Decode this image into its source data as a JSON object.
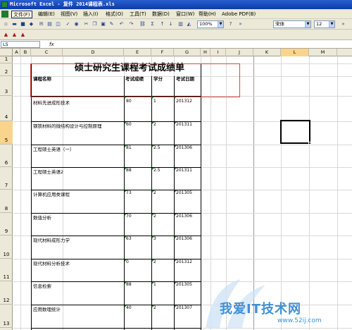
{
  "window": {
    "title": "Microsoft Excel - 复件 2014课程表.xls"
  },
  "menu": [
    "文件(F)",
    "编辑(E)",
    "视图(V)",
    "插入(I)",
    "格式(O)",
    "工具(T)",
    "数据(D)",
    "窗口(W)",
    "帮助(H)",
    "Adobe PDF(B)"
  ],
  "toolbar": {
    "zoom": "100%",
    "font": "宋体",
    "font_size": "12"
  },
  "formula_bar": {
    "name_box": "L5",
    "fx": "fx",
    "content": ""
  },
  "columns": [
    "A",
    "B",
    "C",
    "D",
    "E",
    "F",
    "G",
    "H",
    "I",
    "J",
    "K",
    "L",
    "M"
  ],
  "rows": [
    "1",
    "2",
    "3",
    "4",
    "5",
    "6",
    "7",
    "8",
    "9",
    "10",
    "11",
    "12",
    "13"
  ],
  "active_cell": "L5",
  "sheet": {
    "title": "硕士研究生课程考试成绩单",
    "headers": {
      "course": "课程名称",
      "score": "考试成绩",
      "credit": "学分",
      "date": "考试日期"
    },
    "records": [
      {
        "course": "材料先进成形技术",
        "score": "80",
        "credit": "1",
        "date": "201312"
      },
      {
        "course": "钢铁材料的微结构设计与控制原理",
        "score": "60",
        "credit": "2",
        "date": "201311"
      },
      {
        "course": "工程硕士英语（一）",
        "score": "81",
        "credit": "2.5",
        "date": "201306"
      },
      {
        "course": "工程硕士英语2",
        "score": "88",
        "credit": "2.5",
        "date": "201311"
      },
      {
        "course": "计算机应用类课程",
        "score": "73",
        "credit": "2",
        "date": "201305"
      },
      {
        "course": "数值分析",
        "score": "70",
        "credit": "2",
        "date": "201306"
      },
      {
        "course": "现代材料成形力学",
        "score": "63",
        "credit": "3",
        "date": "201306"
      },
      {
        "course": "现代材料分析技术",
        "score": "0",
        "credit": "2",
        "date": "201312"
      },
      {
        "course": "信息检索",
        "score": "88",
        "credit": "1",
        "date": "201305"
      },
      {
        "course": "应用数理统计",
        "score": "40",
        "credit": "2",
        "date": "201307"
      }
    ]
  },
  "watermark": {
    "text": "我爱IT技术网",
    "url": "www.52ij.com"
  }
}
